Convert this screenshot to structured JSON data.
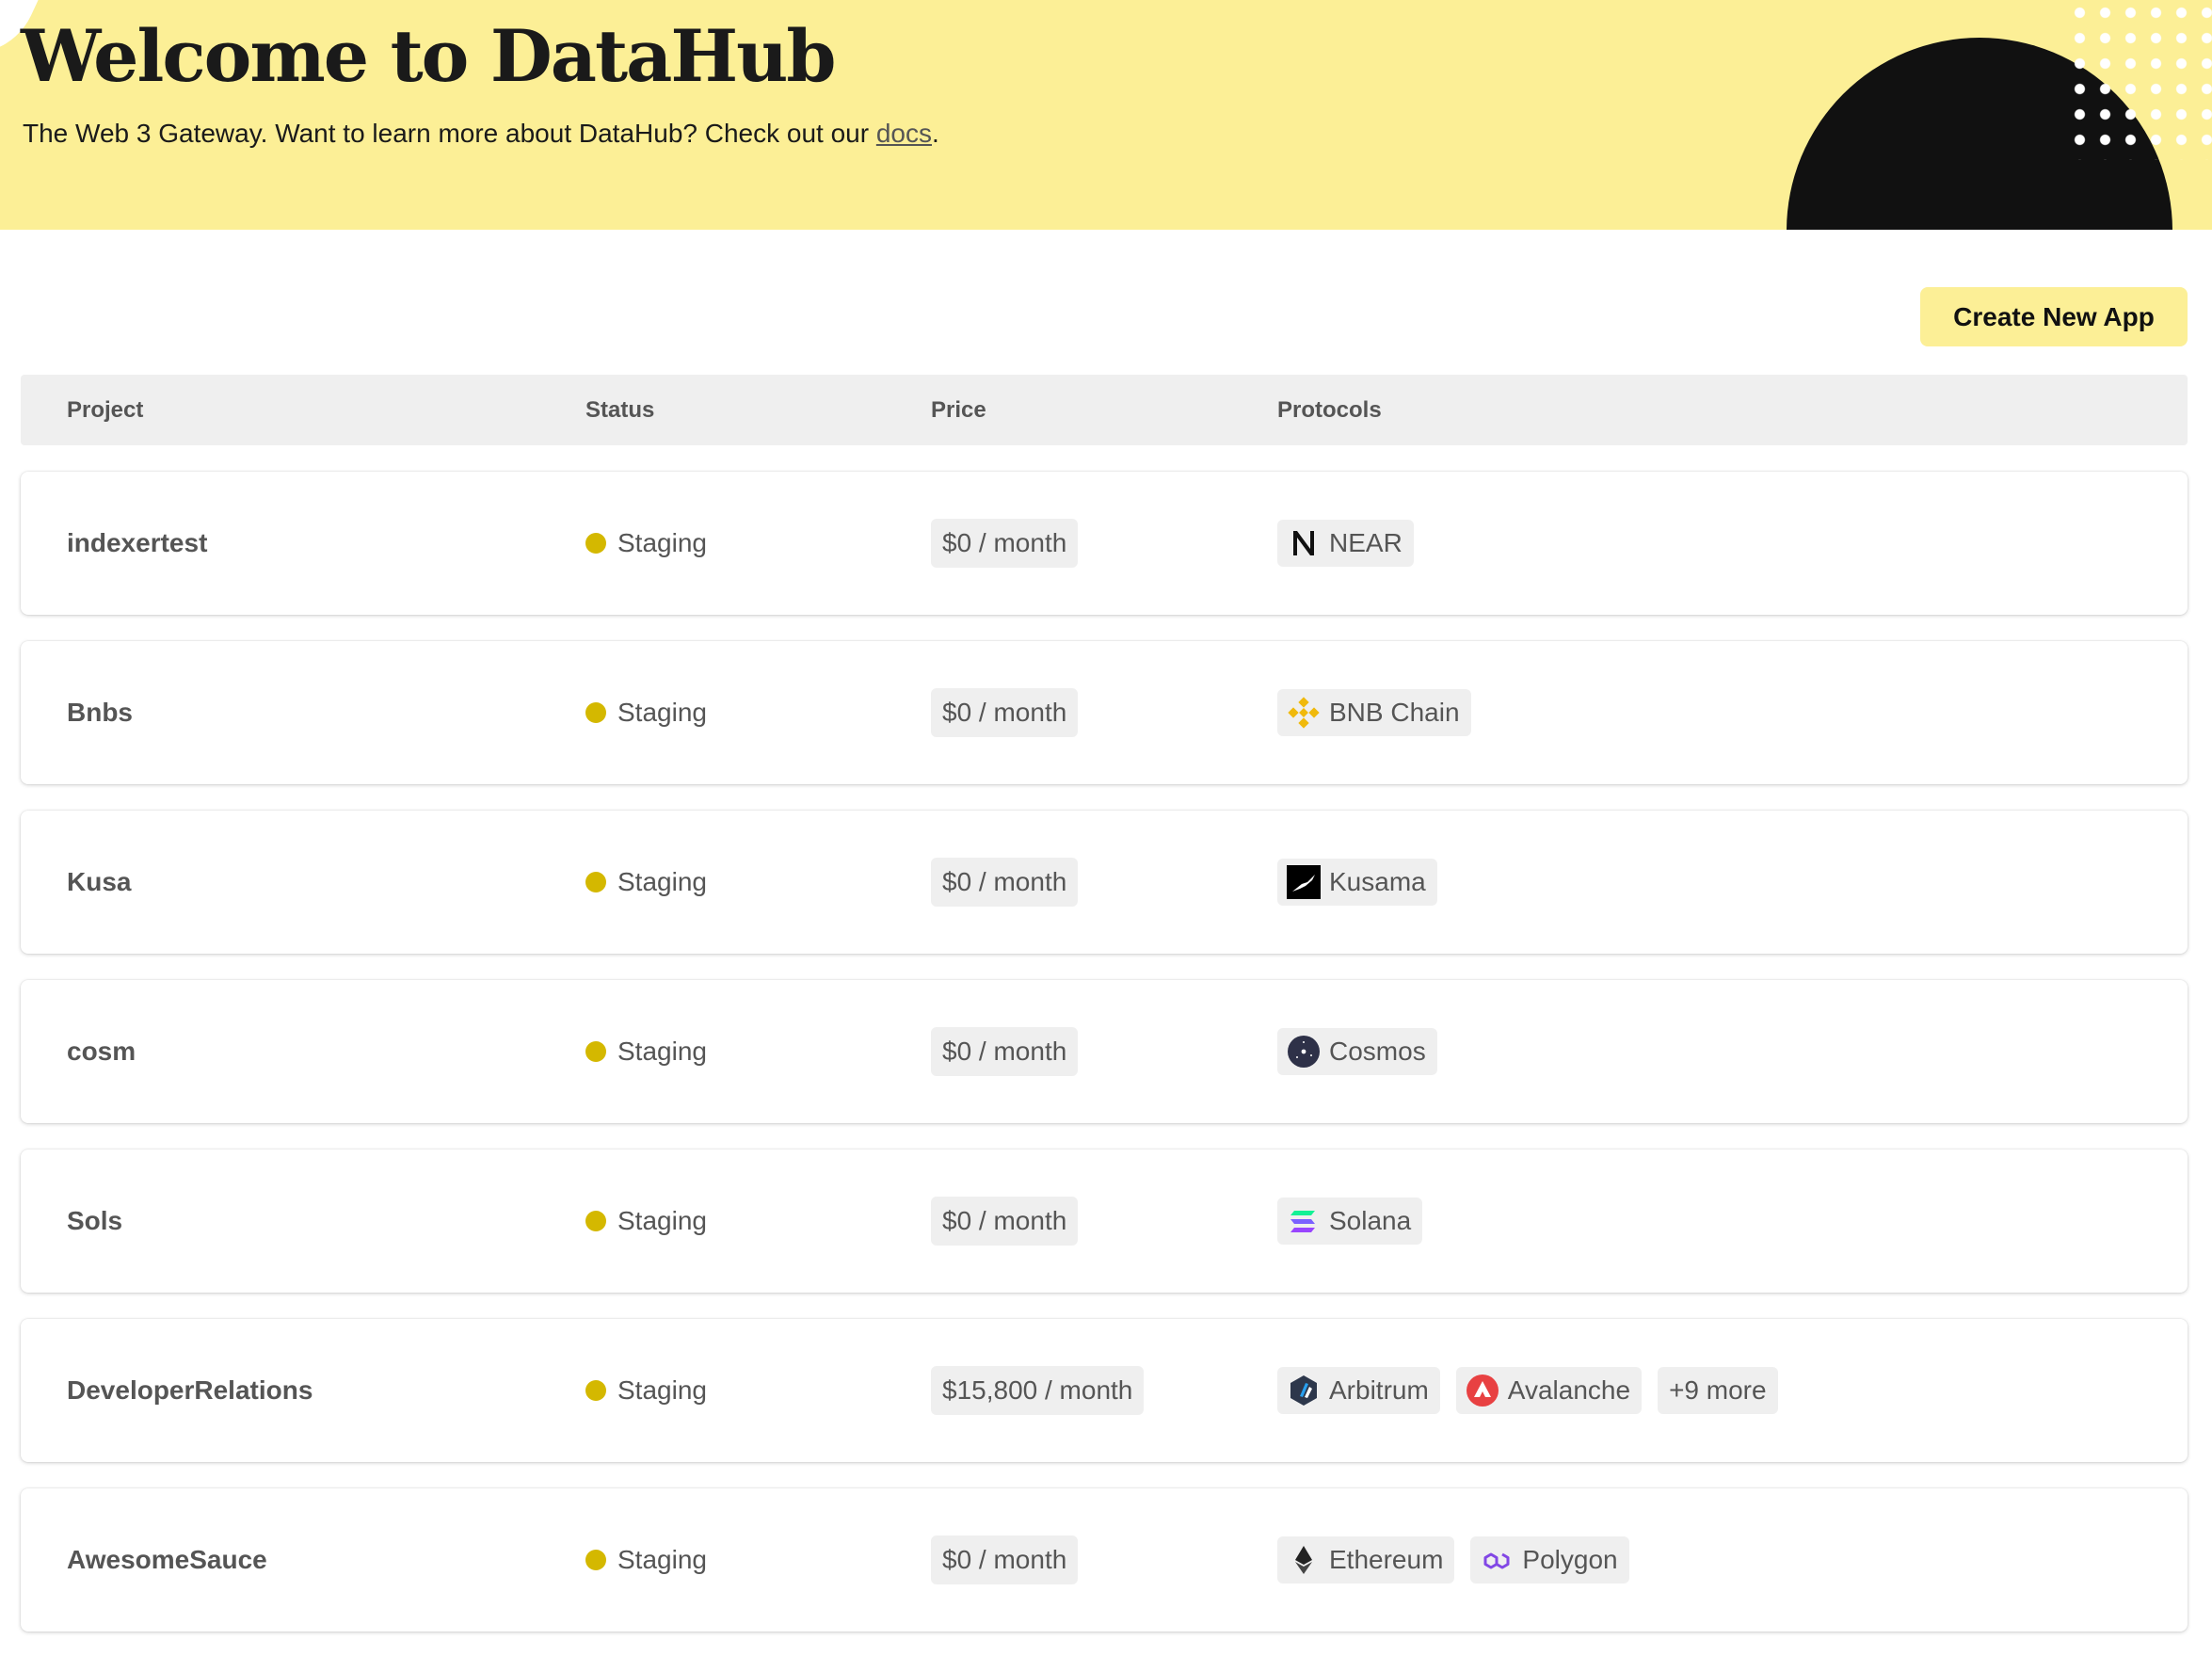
{
  "hero": {
    "title": "Welcome to DataHub",
    "subtitle_prefix": "The Web 3 Gateway. Want to learn more about DataHub? Check out our ",
    "docs_link": "docs",
    "subtitle_suffix": "."
  },
  "actions": {
    "create_label": "Create New App"
  },
  "table": {
    "headers": {
      "project": "Project",
      "status": "Status",
      "price": "Price",
      "protocols": "Protocols"
    },
    "rows": [
      {
        "project": "indexertest",
        "status": "Staging",
        "price": "$0 / month",
        "protocols": [
          {
            "name": "NEAR",
            "icon": "near-icon"
          }
        ]
      },
      {
        "project": "Bnbs",
        "status": "Staging",
        "price": "$0 / month",
        "protocols": [
          {
            "name": "BNB Chain",
            "icon": "bnb-chain-icon"
          }
        ]
      },
      {
        "project": "Kusa",
        "status": "Staging",
        "price": "$0 / month",
        "protocols": [
          {
            "name": "Kusama",
            "icon": "kusama-icon"
          }
        ]
      },
      {
        "project": "cosm",
        "status": "Staging",
        "price": "$0 / month",
        "protocols": [
          {
            "name": "Cosmos",
            "icon": "cosmos-icon"
          }
        ]
      },
      {
        "project": "Sols",
        "status": "Staging",
        "price": "$0 / month",
        "protocols": [
          {
            "name": "Solana",
            "icon": "solana-icon"
          }
        ]
      },
      {
        "project": "DeveloperRelations",
        "status": "Staging",
        "price": "$15,800 / month",
        "protocols": [
          {
            "name": "Arbitrum",
            "icon": "arbitrum-icon"
          },
          {
            "name": "Avalanche",
            "icon": "avalanche-icon"
          }
        ],
        "more": "+9 more"
      },
      {
        "project": "AwesomeSauce",
        "status": "Staging",
        "price": "$0 / month",
        "protocols": [
          {
            "name": "Ethereum",
            "icon": "ethereum-icon"
          },
          {
            "name": "Polygon",
            "icon": "polygon-icon"
          }
        ]
      }
    ]
  },
  "colors": {
    "accent": "#fcef96",
    "status_staging": "#d4b800",
    "chip_bg": "#efefef"
  }
}
